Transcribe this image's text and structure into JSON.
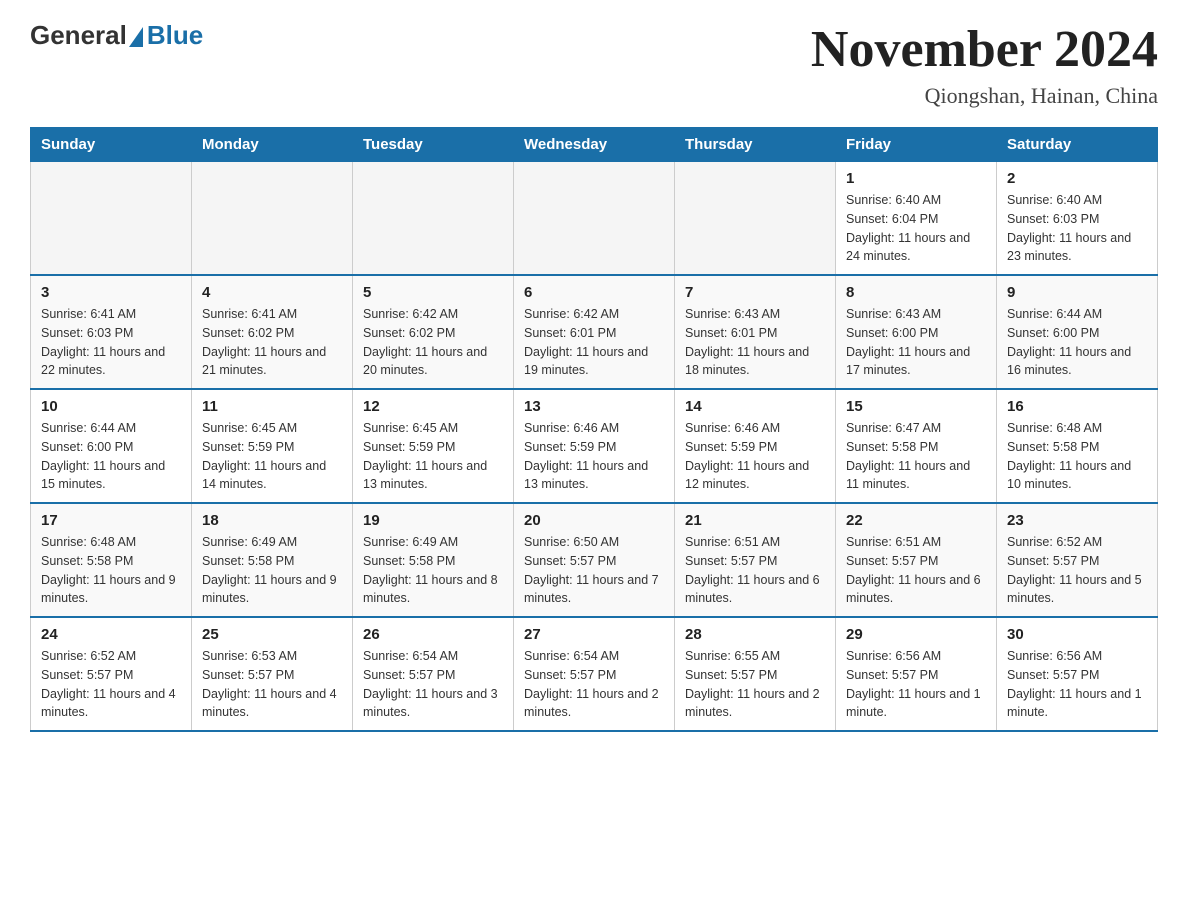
{
  "logo": {
    "general": "General",
    "blue": "Blue"
  },
  "header": {
    "month_year": "November 2024",
    "location": "Qiongshan, Hainan, China"
  },
  "days_of_week": [
    "Sunday",
    "Monday",
    "Tuesday",
    "Wednesday",
    "Thursday",
    "Friday",
    "Saturday"
  ],
  "weeks": [
    [
      {
        "day": "",
        "info": ""
      },
      {
        "day": "",
        "info": ""
      },
      {
        "day": "",
        "info": ""
      },
      {
        "day": "",
        "info": ""
      },
      {
        "day": "",
        "info": ""
      },
      {
        "day": "1",
        "info": "Sunrise: 6:40 AM\nSunset: 6:04 PM\nDaylight: 11 hours and 24 minutes."
      },
      {
        "day": "2",
        "info": "Sunrise: 6:40 AM\nSunset: 6:03 PM\nDaylight: 11 hours and 23 minutes."
      }
    ],
    [
      {
        "day": "3",
        "info": "Sunrise: 6:41 AM\nSunset: 6:03 PM\nDaylight: 11 hours and 22 minutes."
      },
      {
        "day": "4",
        "info": "Sunrise: 6:41 AM\nSunset: 6:02 PM\nDaylight: 11 hours and 21 minutes."
      },
      {
        "day": "5",
        "info": "Sunrise: 6:42 AM\nSunset: 6:02 PM\nDaylight: 11 hours and 20 minutes."
      },
      {
        "day": "6",
        "info": "Sunrise: 6:42 AM\nSunset: 6:01 PM\nDaylight: 11 hours and 19 minutes."
      },
      {
        "day": "7",
        "info": "Sunrise: 6:43 AM\nSunset: 6:01 PM\nDaylight: 11 hours and 18 minutes."
      },
      {
        "day": "8",
        "info": "Sunrise: 6:43 AM\nSunset: 6:00 PM\nDaylight: 11 hours and 17 minutes."
      },
      {
        "day": "9",
        "info": "Sunrise: 6:44 AM\nSunset: 6:00 PM\nDaylight: 11 hours and 16 minutes."
      }
    ],
    [
      {
        "day": "10",
        "info": "Sunrise: 6:44 AM\nSunset: 6:00 PM\nDaylight: 11 hours and 15 minutes."
      },
      {
        "day": "11",
        "info": "Sunrise: 6:45 AM\nSunset: 5:59 PM\nDaylight: 11 hours and 14 minutes."
      },
      {
        "day": "12",
        "info": "Sunrise: 6:45 AM\nSunset: 5:59 PM\nDaylight: 11 hours and 13 minutes."
      },
      {
        "day": "13",
        "info": "Sunrise: 6:46 AM\nSunset: 5:59 PM\nDaylight: 11 hours and 13 minutes."
      },
      {
        "day": "14",
        "info": "Sunrise: 6:46 AM\nSunset: 5:59 PM\nDaylight: 11 hours and 12 minutes."
      },
      {
        "day": "15",
        "info": "Sunrise: 6:47 AM\nSunset: 5:58 PM\nDaylight: 11 hours and 11 minutes."
      },
      {
        "day": "16",
        "info": "Sunrise: 6:48 AM\nSunset: 5:58 PM\nDaylight: 11 hours and 10 minutes."
      }
    ],
    [
      {
        "day": "17",
        "info": "Sunrise: 6:48 AM\nSunset: 5:58 PM\nDaylight: 11 hours and 9 minutes."
      },
      {
        "day": "18",
        "info": "Sunrise: 6:49 AM\nSunset: 5:58 PM\nDaylight: 11 hours and 9 minutes."
      },
      {
        "day": "19",
        "info": "Sunrise: 6:49 AM\nSunset: 5:58 PM\nDaylight: 11 hours and 8 minutes."
      },
      {
        "day": "20",
        "info": "Sunrise: 6:50 AM\nSunset: 5:57 PM\nDaylight: 11 hours and 7 minutes."
      },
      {
        "day": "21",
        "info": "Sunrise: 6:51 AM\nSunset: 5:57 PM\nDaylight: 11 hours and 6 minutes."
      },
      {
        "day": "22",
        "info": "Sunrise: 6:51 AM\nSunset: 5:57 PM\nDaylight: 11 hours and 6 minutes."
      },
      {
        "day": "23",
        "info": "Sunrise: 6:52 AM\nSunset: 5:57 PM\nDaylight: 11 hours and 5 minutes."
      }
    ],
    [
      {
        "day": "24",
        "info": "Sunrise: 6:52 AM\nSunset: 5:57 PM\nDaylight: 11 hours and 4 minutes."
      },
      {
        "day": "25",
        "info": "Sunrise: 6:53 AM\nSunset: 5:57 PM\nDaylight: 11 hours and 4 minutes."
      },
      {
        "day": "26",
        "info": "Sunrise: 6:54 AM\nSunset: 5:57 PM\nDaylight: 11 hours and 3 minutes."
      },
      {
        "day": "27",
        "info": "Sunrise: 6:54 AM\nSunset: 5:57 PM\nDaylight: 11 hours and 2 minutes."
      },
      {
        "day": "28",
        "info": "Sunrise: 6:55 AM\nSunset: 5:57 PM\nDaylight: 11 hours and 2 minutes."
      },
      {
        "day": "29",
        "info": "Sunrise: 6:56 AM\nSunset: 5:57 PM\nDaylight: 11 hours and 1 minute."
      },
      {
        "day": "30",
        "info": "Sunrise: 6:56 AM\nSunset: 5:57 PM\nDaylight: 11 hours and 1 minute."
      }
    ]
  ]
}
